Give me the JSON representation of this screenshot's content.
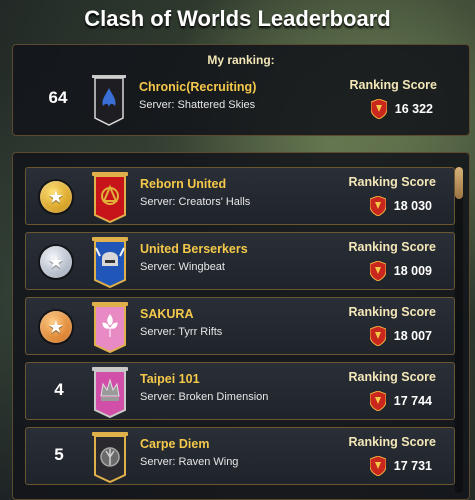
{
  "header": {
    "title": "Clash of Worlds Leaderboard"
  },
  "my_ranking": {
    "label": "My ranking:",
    "rank": "64",
    "guild": "Chronic(Recruiting)",
    "server": "Server: Shattered Skies",
    "score_label": "Ranking Score",
    "score": "16 322",
    "banner_color": "#1e1e22",
    "emblem_color": "#3b6fd6"
  },
  "leaderboard": {
    "rows": [
      {
        "rank": "1",
        "medal": "gold",
        "guild": "Reborn United",
        "server": "Server: Creators' Halls",
        "score_label": "Ranking Score",
        "score": "18 030",
        "banner_color": "#c7141a",
        "emblem_color": "#e2b13a"
      },
      {
        "rank": "2",
        "medal": "silver",
        "guild": "United Berserkers",
        "server": "Server: Wingbeat",
        "score_label": "Ranking Score",
        "score": "18 009",
        "banner_color": "#1f56b8",
        "emblem_color": "#d8d8d8"
      },
      {
        "rank": "3",
        "medal": "bronze",
        "guild": "SAKURA",
        "server": "Server: Tyrr Rifts",
        "score_label": "Ranking Score",
        "score": "18 007",
        "banner_color": "#e88bc4",
        "emblem_color": "#ffffff"
      },
      {
        "rank": "4",
        "medal": "",
        "guild": "Taipei 101",
        "server": "Server: Broken Dimension",
        "score_label": "Ranking Score",
        "score": "17 744",
        "banner_color": "#d14fa8",
        "emblem_color": "#9a9a9a"
      },
      {
        "rank": "5",
        "medal": "",
        "guild": "Carpe Diem",
        "server": "Server: Raven Wing",
        "score_label": "Ranking Score",
        "score": "17 731",
        "banner_color": "#2a2a2e",
        "emblem_color": "#a8a8a8"
      }
    ]
  },
  "colors": {
    "accent_gold": "#f4c84a",
    "panel_border": "#6b5632",
    "score_icon": "#c9261d"
  }
}
